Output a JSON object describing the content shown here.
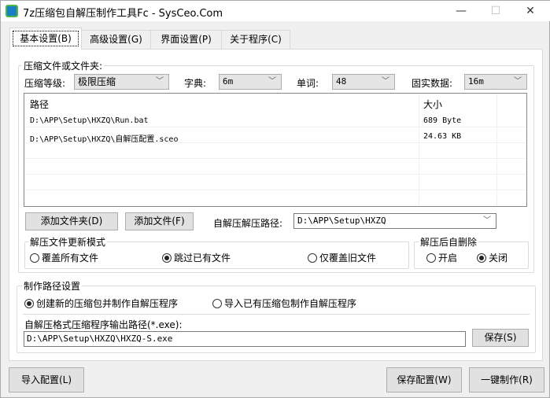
{
  "window": {
    "title": "7z压缩包自解压制作工具Fc - SysCeo.Com",
    "minimize": "—",
    "maximize": "☐",
    "close": "✕"
  },
  "tabs": [
    {
      "label": "基本设置(B)"
    },
    {
      "label": "高级设置(G)"
    },
    {
      "label": "界面设置(P)"
    },
    {
      "label": "关于程序(C)"
    }
  ],
  "compress_group": {
    "label": "压缩文件或文件夹:",
    "level_label": "压缩等级:",
    "level_value": "极限压缩",
    "dict_label": "字典:",
    "dict_value": "6m",
    "word_label": "单词:",
    "word_value": "48",
    "solid_label": "固实数据:",
    "solid_value": "16m"
  },
  "file_list": {
    "columns": [
      "路径",
      "大小"
    ],
    "rows": [
      {
        "path": "D:\\APP\\Setup\\HXZQ\\Run.bat",
        "size": "689 Byte"
      },
      {
        "path": "D:\\APP\\Setup\\HXZQ\\自解压配置.sceo",
        "size": "24.63 KB"
      }
    ]
  },
  "add_folder_button": "添加文件夹(D)",
  "add_file_button": "添加文件(F)",
  "extract_path_label": "自解压解压路径:",
  "extract_path_value": "D:\\APP\\Setup\\HXZQ",
  "update_mode": {
    "label": "解压文件更新模式",
    "options": [
      "覆盖所有文件",
      "跳过已有文件",
      "仅覆盖旧文件"
    ],
    "selected": 1
  },
  "self_delete": {
    "label": "解压后自删除",
    "options": [
      "开启",
      "关闭"
    ],
    "selected": 1
  },
  "make_path": {
    "label": "制作路径设置",
    "options": [
      "创建新的压缩包并制作自解压程序",
      "导入已有压缩包制作自解压程序"
    ],
    "selected": 0,
    "output_label": "自解压格式压缩程序输出路径(*.exe):",
    "output_value": "D:\\APP\\Setup\\HXZQ\\HXZQ-S.exe",
    "save_button": "保存(S)"
  },
  "footer": {
    "import_button": "导入配置(L)",
    "save_config_button": "保存配置(W)",
    "make_button": "一键制作(R)"
  }
}
